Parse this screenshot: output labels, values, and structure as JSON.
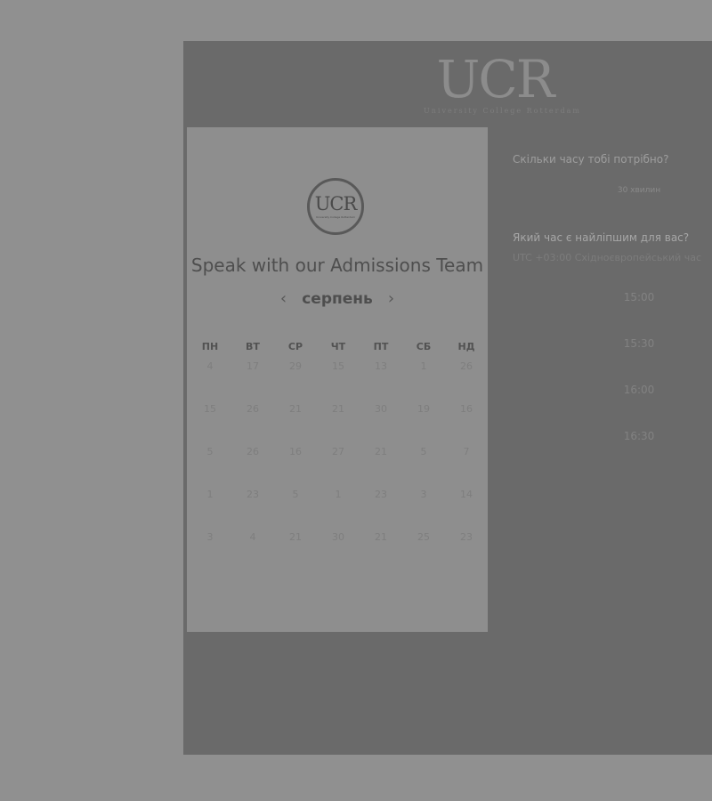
{
  "brand": {
    "logo_text": "UCR",
    "subtitle": "University College Rotterdam"
  },
  "calendar_card": {
    "logo_text": "UCR",
    "logo_subtitle": "University College Rotterdam",
    "title": "Speak with our Admissions Team",
    "prev_arrow": "‹",
    "next_arrow": "›",
    "month": "серпень",
    "weekdays": [
      "ПН",
      "ВТ",
      "СР",
      "ЧТ",
      "ПТ",
      "СБ",
      "НД"
    ],
    "weeks": [
      [
        "4",
        "17",
        "29",
        "15",
        "13",
        "1",
        "26"
      ],
      [
        "15",
        "26",
        "21",
        "21",
        "30",
        "19",
        "16"
      ],
      [
        "5",
        "26",
        "16",
        "27",
        "21",
        "5",
        "7"
      ],
      [
        "1",
        "23",
        "5",
        "1",
        "23",
        "3",
        "14"
      ],
      [
        "3",
        "4",
        "21",
        "30",
        "21",
        "25",
        "23"
      ]
    ]
  },
  "scheduler": {
    "duration_question": "Скільки часу тобі потрібно?",
    "duration_value": "30 хвилин",
    "time_question": "Який час є найліпшим для вас?",
    "timezone": "UTC +03:00 Східноєвропейський час",
    "time_slots": [
      "15:00",
      "15:30",
      "16:00",
      "16:30"
    ]
  }
}
